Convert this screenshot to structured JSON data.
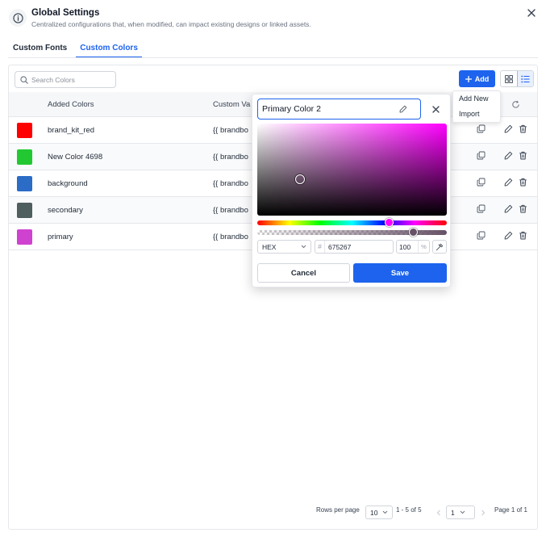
{
  "header": {
    "title": "Global Settings",
    "subtitle": "Centralized configurations that, when modified, can impact existing designs or linked assets."
  },
  "tabs": [
    {
      "label": "Custom Fonts",
      "active": false
    },
    {
      "label": "Custom Colors",
      "active": true
    }
  ],
  "toolbar": {
    "search_placeholder": "Search Colors",
    "add_label": "Add",
    "add_menu": [
      "Add New",
      "Import"
    ]
  },
  "table": {
    "columns": [
      "Added Colors",
      "Custom Va"
    ],
    "rows": [
      {
        "name": "brand_kit_red",
        "value": "{{ brandbo",
        "color": "#ff0000"
      },
      {
        "name": "New Color 4698",
        "value": "{{ brandbo",
        "color": "#22c832"
      },
      {
        "name": "background",
        "value": "{{ brandbo",
        "color": "#2a6cc6"
      },
      {
        "name": "secondary",
        "value": "{{ brandbo",
        "color": "#4f5e5f"
      },
      {
        "name": "primary",
        "value": "{{ brandbo",
        "color": "#cf42cf"
      }
    ]
  },
  "pagination": {
    "rows_per_page_label": "Rows per page",
    "rows_per_page": "10",
    "range": "1 - 5 of 5",
    "page": "1",
    "page_of": "Page 1 of 1"
  },
  "color_picker": {
    "name": "Primary Color 2",
    "format": "HEX",
    "hex": "675267",
    "hash": "#",
    "opacity": "100",
    "percent": "%",
    "hue_position": 0.693,
    "alpha_position": 0.82,
    "preview_hue_color": "#ff00ff",
    "cancel_label": "Cancel",
    "save_label": "Save"
  },
  "colors": {
    "accent": "#1d63ed"
  }
}
